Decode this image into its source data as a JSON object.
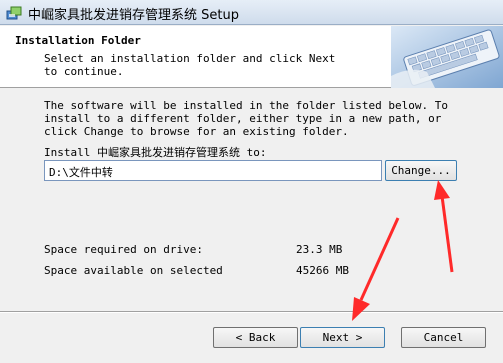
{
  "window": {
    "title": "中崛家具批发进销存管理系统 Setup"
  },
  "header": {
    "title": "Installation Folder",
    "subtitle": "Select an installation folder and click Next to continue."
  },
  "main": {
    "description": "The software will be installed in the folder listed below. To install to a different folder, either type in a new path, or click Change to browse for an existing folder.",
    "install_label": "Install 中崛家具批发进销存管理系统 to:",
    "path_value": "D:\\文件中转",
    "change_label": "Change...",
    "space_required_label": "Space required on drive:",
    "space_required_value": "23.3 MB",
    "space_available_label": "Space available on selected",
    "space_available_value": "45266 MB"
  },
  "footer": {
    "back_label": "< Back",
    "next_label": "Next >",
    "cancel_label": "Cancel"
  },
  "icons": {
    "title": "installer-icon",
    "header": "keyboard-graphic"
  },
  "colors": {
    "annotation_arrow": "#ff2a2a",
    "focus_border": "#3c7fb1"
  }
}
